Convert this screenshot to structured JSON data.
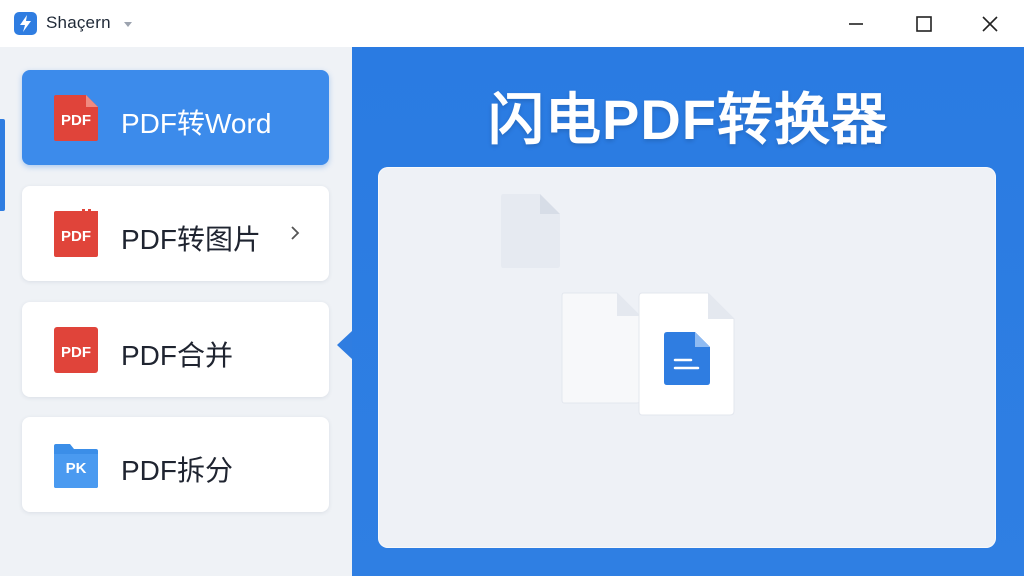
{
  "window": {
    "app_name": "Shaçern",
    "controls": [
      "minimize",
      "maximize",
      "close"
    ]
  },
  "sidebar": {
    "items": [
      {
        "label": "PDF转Word",
        "icon_text": "PDF",
        "icon": "pdf-file-icon",
        "active": true
      },
      {
        "label": "PDF转图片",
        "icon_text": "PDF",
        "icon": "pdf-file-icon",
        "has_chevron": true
      },
      {
        "label": "PDF合并",
        "icon_text": "PDF",
        "icon": "pdf-file-icon"
      },
      {
        "label": "PDF拆分",
        "icon_text": "PK",
        "icon": "folder-icon"
      }
    ]
  },
  "main": {
    "title": "闪电PDF转换器"
  },
  "colors": {
    "accent": "#2f7de1",
    "active_item": "#3c8beb",
    "pdf_red": "#e0443a",
    "folder_blue": "#3b8ee8",
    "dropzone": "#eef1f6"
  }
}
